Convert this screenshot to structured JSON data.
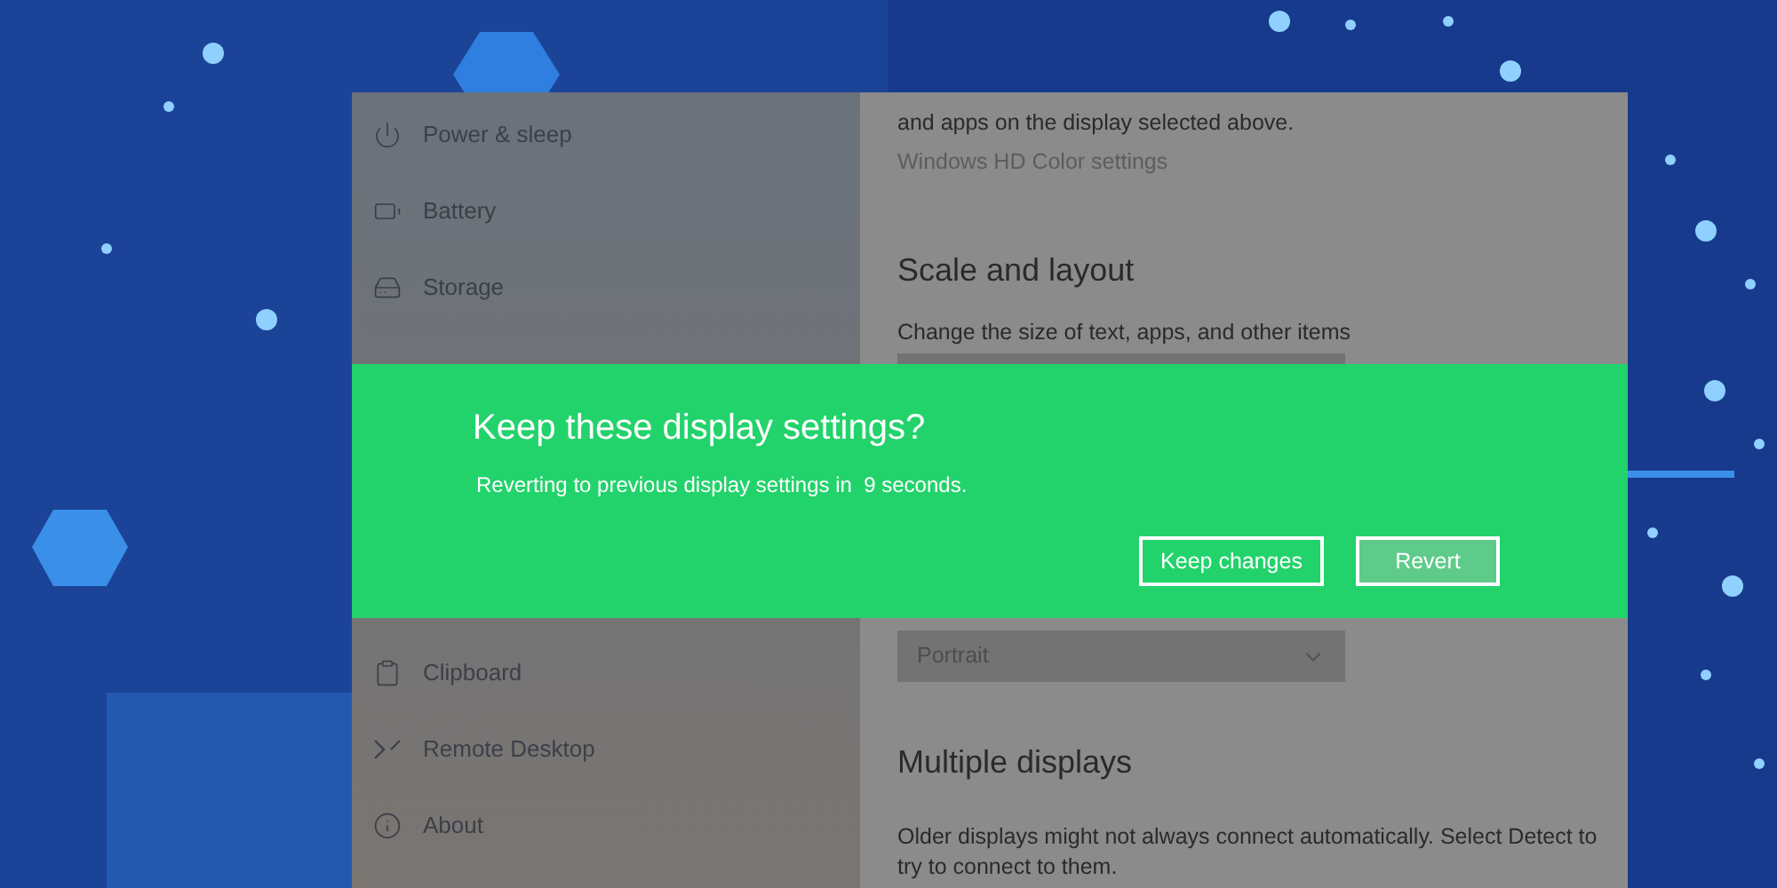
{
  "sidebar": {
    "items_top": [
      {
        "label": "Power & sleep"
      },
      {
        "label": "Battery"
      },
      {
        "label": "Storage"
      }
    ],
    "items_bottom": [
      {
        "label": "Clipboard"
      },
      {
        "label": "Remote Desktop"
      },
      {
        "label": "About"
      }
    ]
  },
  "content": {
    "hdr_text": "and apps on the display selected above.",
    "hdr_link": "Windows HD Color settings",
    "scale_heading": "Scale and layout",
    "scale_label": "Change the size of text, apps, and other items",
    "orientation_value": "Portrait",
    "multiple_heading": "Multiple displays",
    "multiple_text": "Older displays might not always connect automatically. Select Detect to try to connect to them."
  },
  "dialog": {
    "title": "Keep these display settings?",
    "message": "Reverting to previous display settings in  9 seconds.",
    "buttons": [
      {
        "label": "Keep changes",
        "kind": "outline"
      },
      {
        "label": "Revert",
        "kind": "filled"
      }
    ]
  }
}
